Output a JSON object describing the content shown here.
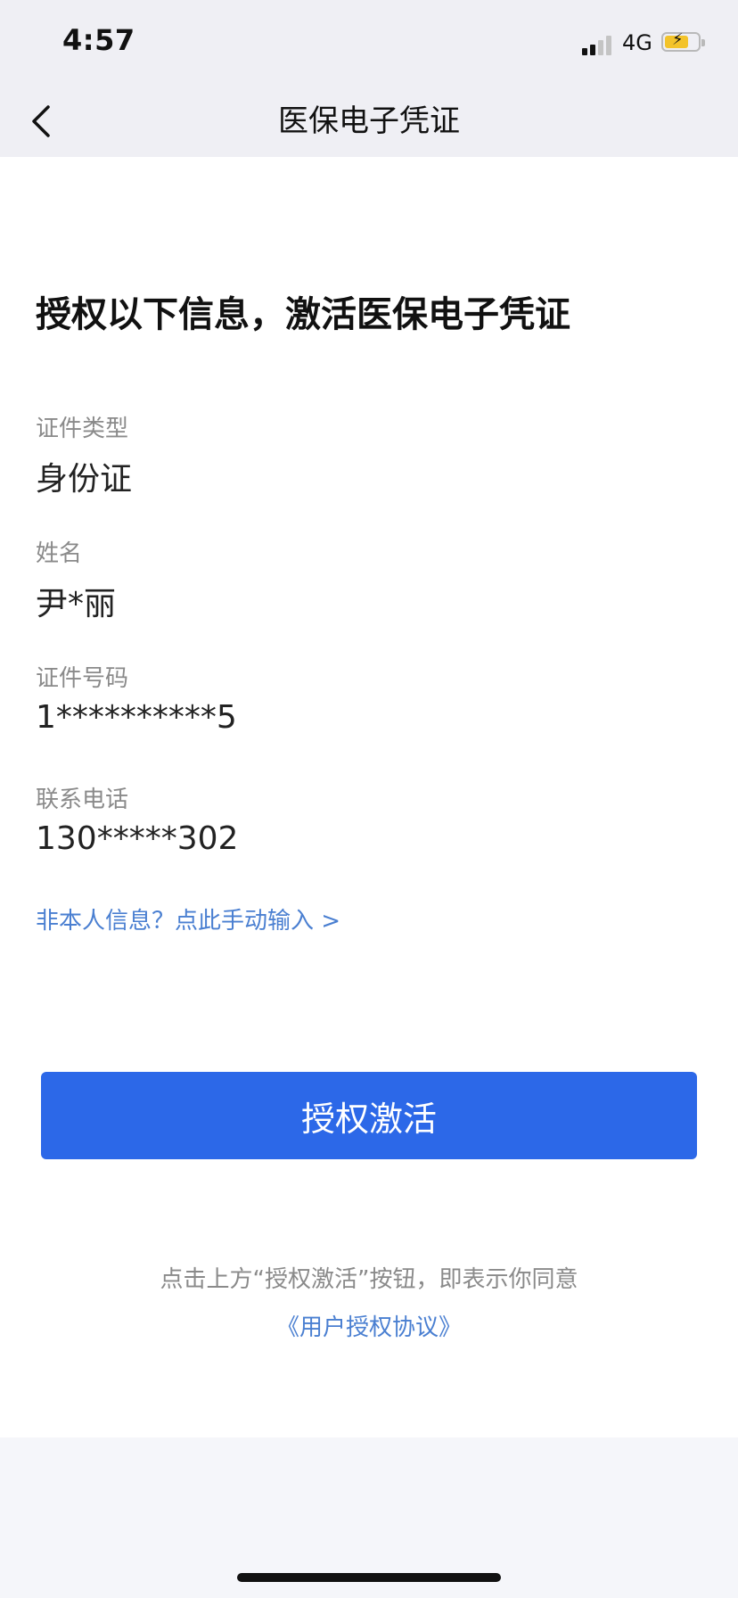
{
  "status_bar": {
    "time": "4:57",
    "network": "4G",
    "signal_bars_active": 2,
    "battery_level": 0.6,
    "battery_color": "#f3c32a"
  },
  "navbar": {
    "back_icon": "chevron-left-icon",
    "title": "医保电子凭证"
  },
  "main": {
    "headline": "授权以下信息，激活医保电子凭证",
    "fields": [
      {
        "label": "证件类型",
        "value": "身份证"
      },
      {
        "label": "姓名",
        "value": "尹*丽"
      },
      {
        "label": "证件号码",
        "value": "1**********5"
      },
      {
        "label": "联系电话",
        "value": "130*****302"
      }
    ],
    "manual_link": "非本人信息？点此手动输入 >",
    "primary_button": "授权激活",
    "consent_text": "点击上方“授权激活”按钮，即表示你同意",
    "agreement_link": "《用户授权协议》"
  },
  "colors": {
    "accent": "#2c68e8",
    "link": "#4a7fd1",
    "label": "#8a8a8a"
  }
}
